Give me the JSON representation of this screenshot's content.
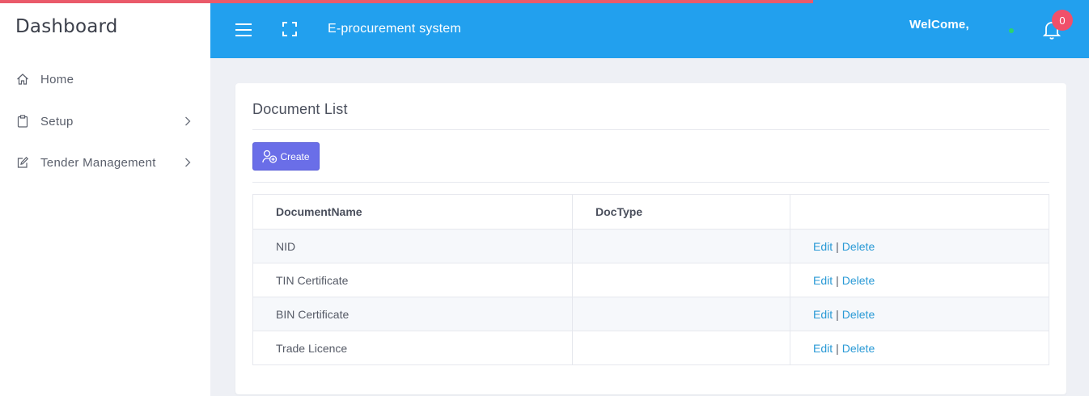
{
  "sidebar": {
    "brand": "Dashboard",
    "items": [
      {
        "label": "Home",
        "icon": "home-icon"
      },
      {
        "label": "Setup",
        "icon": "clipboard-icon"
      },
      {
        "label": "Tender Management",
        "icon": "edit-icon"
      }
    ]
  },
  "topbar": {
    "app_title": "E-procurement system",
    "welcome": "WelCome,",
    "notification_count": "0",
    "colors": {
      "bar": "#22a0ee",
      "badge": "#f0506a",
      "online": "#2bd46e"
    }
  },
  "main": {
    "card_title": "Document List",
    "create_label": "Create",
    "table": {
      "headers": [
        "DocumentName",
        "DocType",
        ""
      ],
      "rows": [
        {
          "name": "NID",
          "type": ""
        },
        {
          "name": "TIN Certificate",
          "type": ""
        },
        {
          "name": "BIN Certificate",
          "type": ""
        },
        {
          "name": "Trade Licence",
          "type": ""
        }
      ],
      "edit_label": "Edit",
      "separator": "|",
      "delete_label": "Delete"
    }
  }
}
